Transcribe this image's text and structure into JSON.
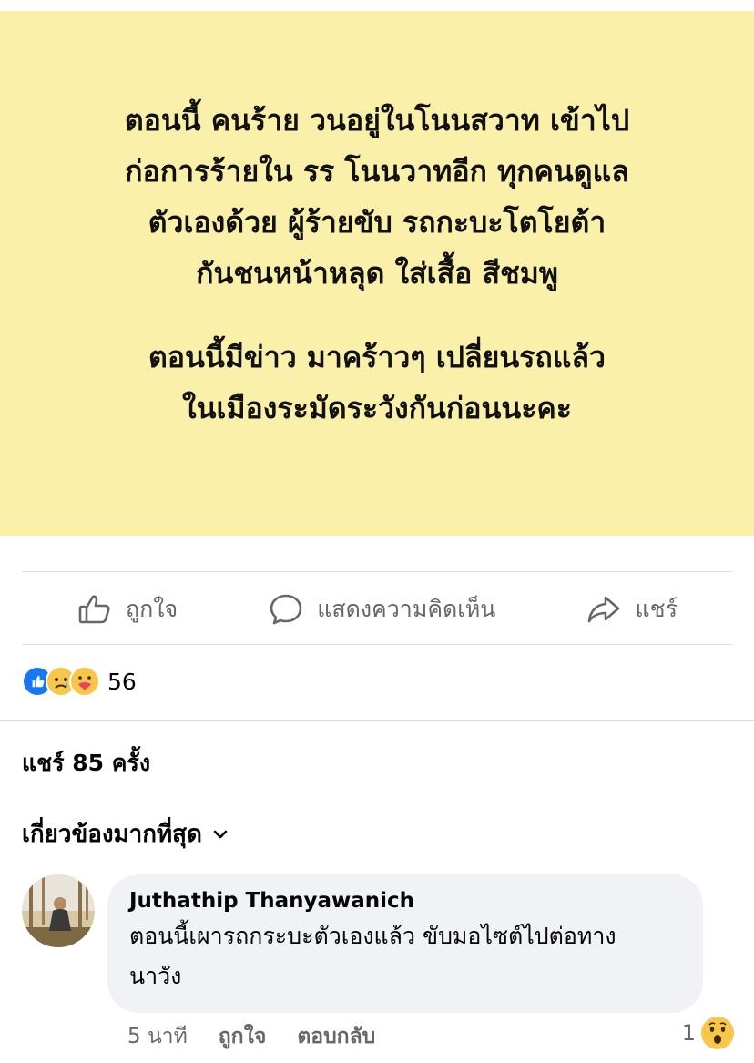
{
  "post": {
    "status_paragraphs": [
      [
        "ตอนนี้ คนร้าย วนอยู่ในโนนสวาท เข้าไป",
        "ก่อการร้ายใน รร โนนวาทอีก ทุกคนดูแล",
        "ตัวเองด้วย ผู้ร้ายขับ รถกะบะโตโยต้า",
        "กันชนหน้าหลุด ใส่เสื้อ สีชมพู"
      ],
      [
        "ตอนนี้มีข่าว มาคร้าวๆ เปลี่ยนรถแล้ว",
        "ในเมืองระมัดระวังกันก่อนนะคะ"
      ]
    ],
    "background_color": "#fbf0a9"
  },
  "actions": {
    "like": "ถูกใจ",
    "comment": "แสดงความคิดเห็น",
    "share": "แชร์"
  },
  "reactions": {
    "icons": [
      "like-reaction-icon",
      "sad-reaction-icon",
      "care-reaction-icon"
    ],
    "count": "56"
  },
  "shares": "แชร์ 85 ครั้ง",
  "sort_label": "เกี่ยวข้องมากที่สุด",
  "comment": {
    "author": "Juthathip Thanyawanich",
    "text_lines": [
      "ตอนนี้เผารถกระบะตัวเองแล้ว ขับมอไซต์ไปต่อทาง",
      "นาวัง"
    ],
    "time": "5 นาที",
    "like": "ถูกใจ",
    "reply": "ตอบกลับ",
    "reaction_count": "1",
    "reaction_icon": "wow-reaction-icon"
  },
  "colors": {
    "secondary_text": "#65676b",
    "like_blue": "#1877f2",
    "bubble": "#f0f2f5"
  }
}
